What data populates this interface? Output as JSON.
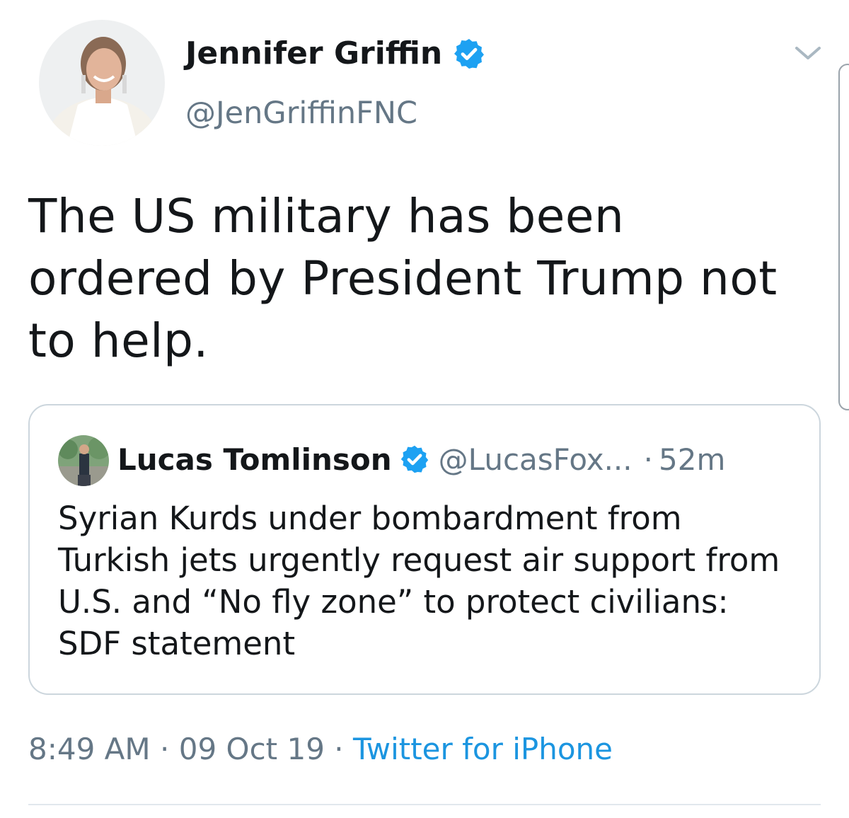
{
  "tweet": {
    "author": {
      "name": "Jennifer Griffin",
      "handle": "@JenGriffinFNC",
      "verified": true
    },
    "text": "The US military has been ordered by President Trump not to help.",
    "time": "8:49 AM",
    "date": "09 Oct 19",
    "source": "Twitter for iPhone",
    "separator": "·"
  },
  "quoted_tweet": {
    "author": {
      "name": "Lucas Tomlinson",
      "handle": "@LucasFox...",
      "verified": true
    },
    "time": "52m",
    "separator": "·",
    "text": "Syrian Kurds under bombardment from Turkish jets urgently request air support from U.S. and “No fly zone” to protect civilians: SDF statement"
  },
  "icons": {
    "verified": "verified-badge-icon",
    "caret": "chevron-down-icon"
  },
  "colors": {
    "primary_text": "#14171a",
    "secondary_text": "#657786",
    "link": "#1b95e0",
    "verified": "#1da1f2",
    "border": "#ccd6dd"
  }
}
